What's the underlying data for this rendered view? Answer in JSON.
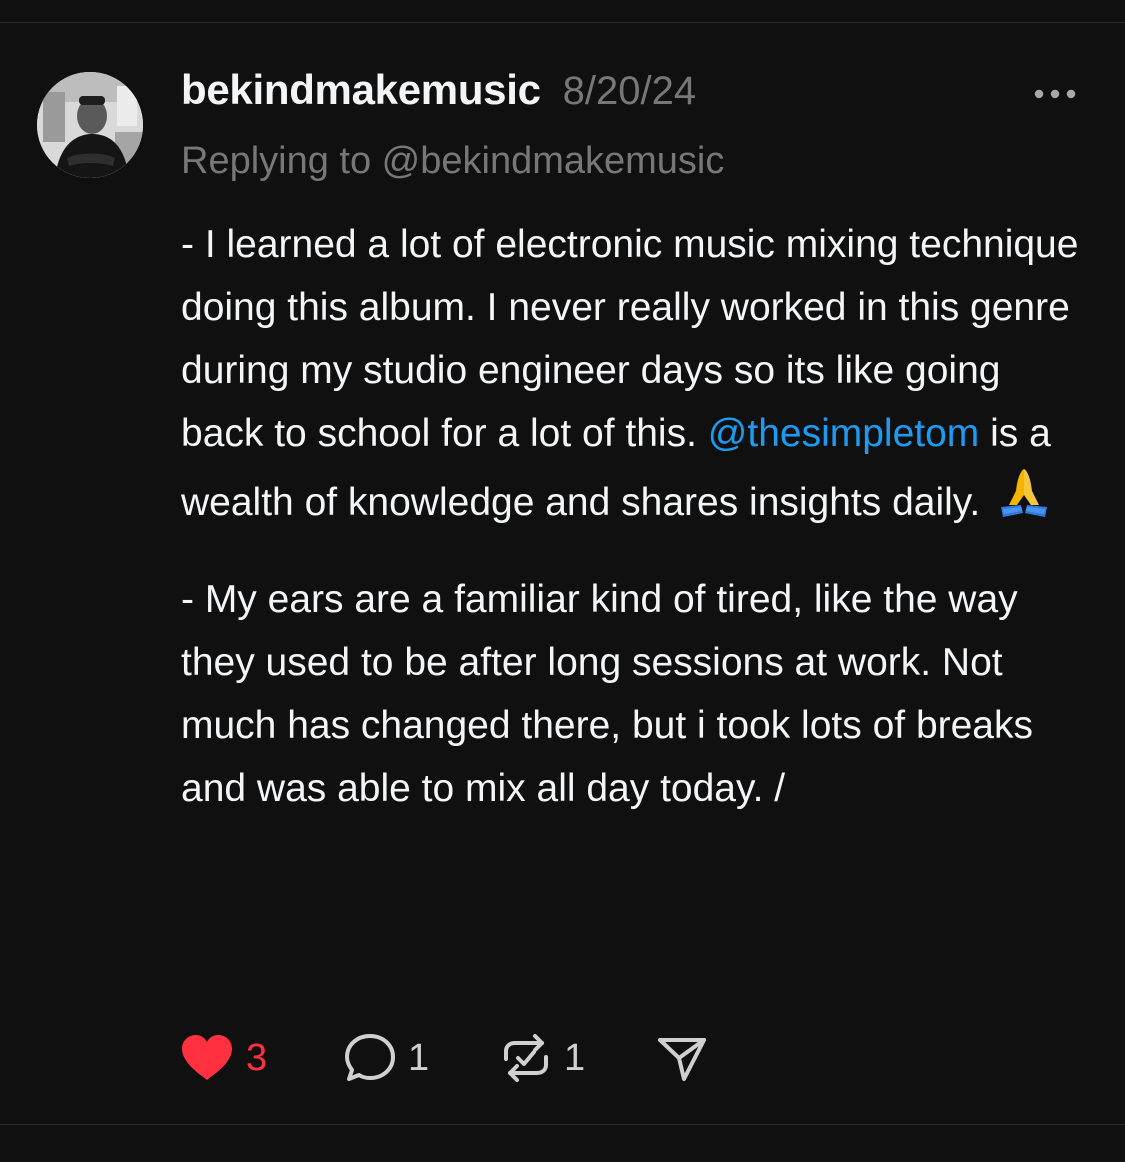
{
  "post": {
    "author": "bekindmakemusic",
    "date": "8/20/24",
    "replying_to": "Replying to @bekindmakemusic",
    "paragraph1_text": "- I learned a lot of electronic music mixing technique doing this album. I never really worked in this genre during my studio engineer days so its like going back to school for a lot of this. ",
    "paragraph1_mention": "@thesimpletom",
    "paragraph1_rest": " is a wealth of knowledge and shares insights daily. ",
    "paragraph1_emoji": "folded-hands-emoji",
    "paragraph2": "- My ears are a familiar kind of tired, like the way they used to be after long sessions at work. Not much has changed there, but i took lots of breaks and was able to mix all day today. /"
  },
  "actions": {
    "likes": "3",
    "replies": "1",
    "reposts": "1"
  },
  "icons": {
    "more": "more-horizontal-icon",
    "like": "heart-icon",
    "reply": "speech-bubble-icon",
    "repost": "repost-icon",
    "share": "paper-plane-icon"
  },
  "colors": {
    "background": "#101010",
    "mention": "#1d9bf0",
    "like_active": "#ff3040",
    "secondary_text": "#777777"
  }
}
